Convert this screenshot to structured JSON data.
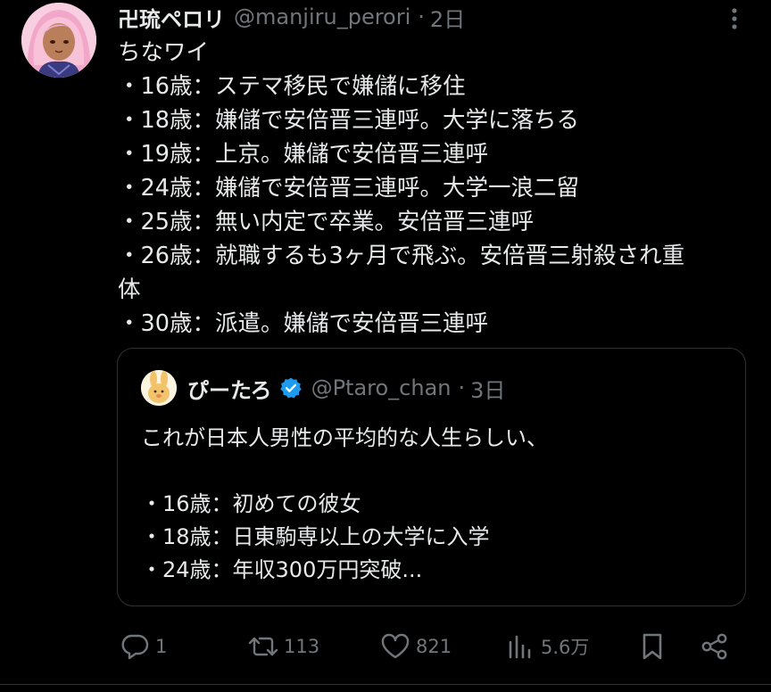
{
  "tweet": {
    "display_name": "卍琉ペロリ",
    "handle": "@manjiru_perori",
    "time": "2日",
    "lines": [
      "ちなワイ",
      "・16歳：ステマ移民で嫌儲に移住",
      "・18歳：嫌儲で安倍晋三連呼。大学に落ちる",
      "・19歳：上京。嫌儲で安倍晋三連呼",
      "・24歳：嫌儲で安倍晋三連呼。大学一浪二留",
      "・25歳：無い内定で卒業。安倍晋三連呼",
      "・26歳：就職するも3ヶ月で飛ぶ。安倍晋三射殺され重",
      "体",
      "・30歳：派遣。嫌儲で安倍晋三連呼"
    ]
  },
  "quote": {
    "display_name": "ぴーたろ",
    "handle": "@Ptaro_chan",
    "time": "3日",
    "lines": [
      "これが日本人男性の平均的な人生らしい、",
      "",
      "・16歳：初めての彼女",
      "・18歳：日東駒専以上の大学に入学",
      "・24歳：年収300万円突破..."
    ]
  },
  "actions": {
    "replies": "1",
    "reposts": "113",
    "likes": "821",
    "views": "5.6万"
  },
  "icons": {
    "more": "more-vertical-icon",
    "verified": "verified-badge-icon",
    "reply": "reply-icon",
    "repost": "repost-icon",
    "like": "heart-icon",
    "views": "views-chart-icon",
    "bookmark": "bookmark-icon",
    "share": "share-icon"
  },
  "colors": {
    "background": "#000000",
    "text": "#e7e9ea",
    "secondary": "#71767b",
    "border": "#2f3336",
    "verified": "#1d9bf0"
  }
}
